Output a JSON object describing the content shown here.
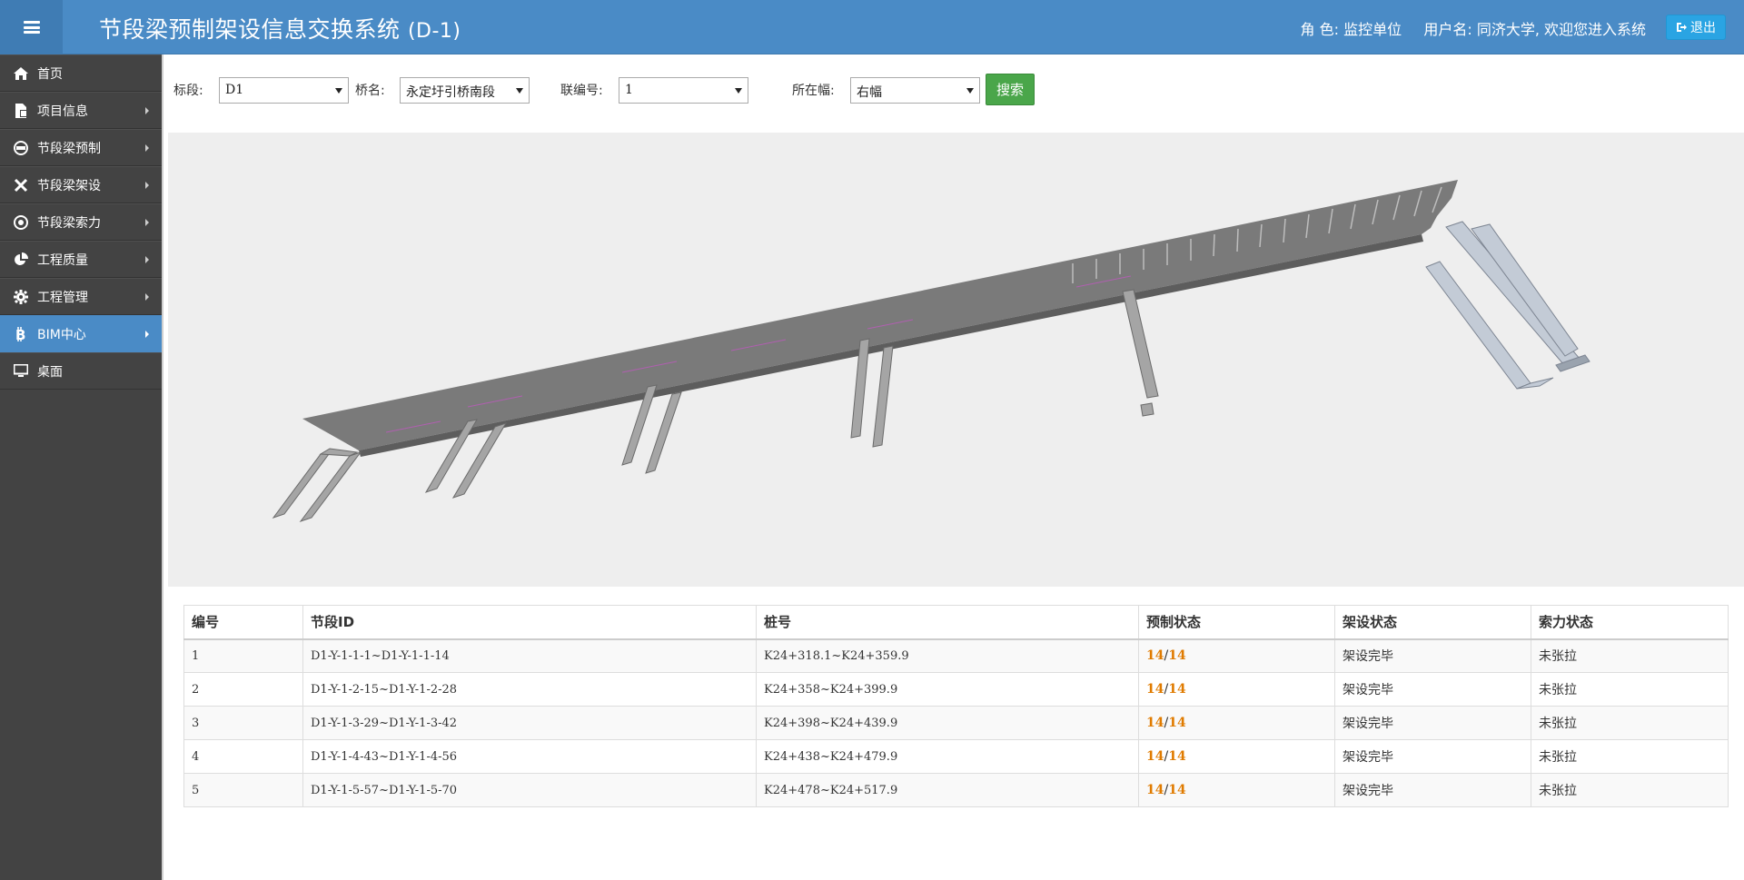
{
  "header": {
    "title": "节段梁预制架设信息交换系统",
    "title_suffix": "(D-1)",
    "role_label": "角  色:",
    "role_value": "监控单位",
    "user_label": "用户名:",
    "user_value": "同济大学, 欢迎您进入系统",
    "logout_label": "退出",
    "bg_color": "#4a8bc6"
  },
  "sidebar": {
    "items": [
      {
        "label": "首页",
        "icon": "home-icon",
        "has_arrow": false,
        "active": false
      },
      {
        "label": "项目信息",
        "icon": "document-icon",
        "has_arrow": true,
        "active": false
      },
      {
        "label": "节段梁预制",
        "icon": "factory-icon",
        "has_arrow": true,
        "active": false
      },
      {
        "label": "节段梁架设",
        "icon": "crane-icon",
        "has_arrow": true,
        "active": false
      },
      {
        "label": "节段梁索力",
        "icon": "tension-icon",
        "has_arrow": true,
        "active": false
      },
      {
        "label": "工程质量",
        "icon": "pie-chart-icon",
        "has_arrow": true,
        "active": false
      },
      {
        "label": "工程管理",
        "icon": "gear-icon",
        "has_arrow": true,
        "active": false
      },
      {
        "label": "BIM中心",
        "icon": "bitcoin-icon",
        "has_arrow": true,
        "active": true
      },
      {
        "label": "桌面",
        "icon": "monitor-icon",
        "has_arrow": false,
        "active": false
      }
    ]
  },
  "filters": {
    "section_label": "标段:",
    "section_value": "D1",
    "bridge_label": "桥名:",
    "bridge_value": "永定圩引桥南段",
    "unit_label": "联编号:",
    "unit_value": "1",
    "side_label": "所在幅:",
    "side_value": "右幅",
    "search_label": "搜索"
  },
  "table": {
    "headers": [
      "编号",
      "节段ID",
      "桩号",
      "预制状态",
      "架设状态",
      "索力状态"
    ],
    "rows": [
      {
        "no": "1",
        "id": "D1-Y-1-1-1~D1-Y-1-1-14",
        "station": "K24+318.1~K24+359.9",
        "precast_done": "14",
        "precast_total": "14",
        "erect": "架设完毕",
        "tension": "未张拉"
      },
      {
        "no": "2",
        "id": "D1-Y-1-2-15~D1-Y-1-2-28",
        "station": "K24+358~K24+399.9",
        "precast_done": "14",
        "precast_total": "14",
        "erect": "架设完毕",
        "tension": "未张拉"
      },
      {
        "no": "3",
        "id": "D1-Y-1-3-29~D1-Y-1-3-42",
        "station": "K24+398~K24+439.9",
        "precast_done": "14",
        "precast_total": "14",
        "erect": "架设完毕",
        "tension": "未张拉"
      },
      {
        "no": "4",
        "id": "D1-Y-1-4-43~D1-Y-1-4-56",
        "station": "K24+438~K24+479.9",
        "precast_done": "14",
        "precast_total": "14",
        "erect": "架设完毕",
        "tension": "未张拉"
      },
      {
        "no": "5",
        "id": "D1-Y-1-5-57~D1-Y-1-5-70",
        "station": "K24+478~K24+517.9",
        "precast_done": "14",
        "precast_total": "14",
        "erect": "架设完毕",
        "tension": "未张拉"
      }
    ]
  },
  "colors": {
    "accent": "#4a8bc6",
    "sidebar_bg": "#434343",
    "search_button": "#4aa64a",
    "status_highlight": "#e07b00",
    "viewer_bg": "#eeeeee"
  }
}
